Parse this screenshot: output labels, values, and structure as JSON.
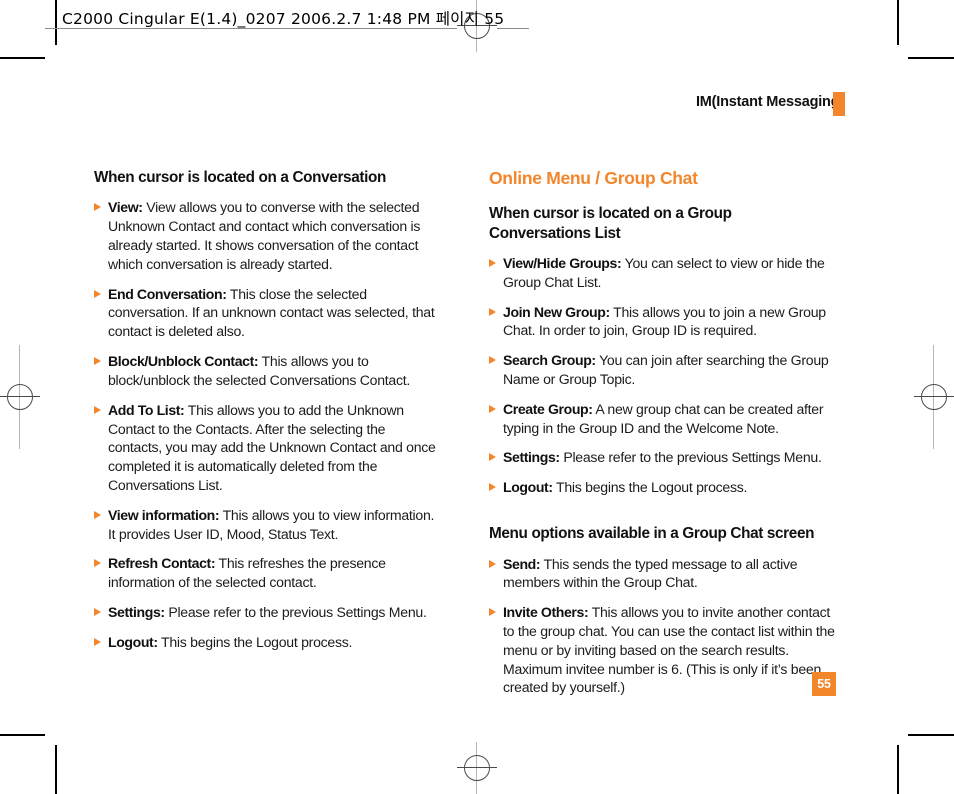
{
  "prepress": {
    "slug": "C2000 Cingular  E(1.4)_0207  2006.2.7 1:48 PM  페이지 55"
  },
  "running_head": {
    "label": "IM(Instant Messaging)"
  },
  "folio": {
    "page_number": "55"
  },
  "colors": {
    "accent": "#F3852B",
    "text": "#1c1c1c",
    "heading": "#111111",
    "folio_text": "#ffffff"
  },
  "columns": {
    "left": {
      "heading": "When cursor is located on a Conversation",
      "items": [
        {
          "term": "View:",
          "desc": " View allows you to converse with the selected Unknown Contact and contact which conversation is already started. It shows conversation of the contact which conversation is already started."
        },
        {
          "term": "End Conversation:",
          "desc": " This close the selected conversation. If an unknown contact was selected, that contact is deleted also."
        },
        {
          "term": "Block/Unblock Contact:",
          "desc": " This allows you to block/unblock the selected Conversations Contact."
        },
        {
          "term": "Add To List:",
          "desc": " This allows you to add the Unknown Contact to the Contacts. After the selecting the contacts, you may add the Unknown Contact and once completed it is automatically deleted from the Conversations List."
        },
        {
          "term": "View information:",
          "desc": " This allows you to view information. It provides User ID, Mood, Status Text."
        },
        {
          "term": "Refresh Contact:",
          "desc": " This refreshes the presence information of the selected contact."
        },
        {
          "term": "Settings:",
          "desc": " Please refer to the previous Settings Menu."
        },
        {
          "term": "Logout:",
          "desc": " This begins the Logout process."
        }
      ]
    },
    "right": {
      "section_title": "Online Menu / Group Chat",
      "heading_1": "When cursor is located on a Group Conversations List",
      "items_1": [
        {
          "term": "View/Hide Groups:",
          "desc": " You can select to view or hide the Group Chat List."
        },
        {
          "term": "Join New Group:",
          "desc": " This allows you to join a new Group Chat. In order to join, Group ID is required."
        },
        {
          "term": "Search Group:",
          "desc": " You can join after searching the Group Name or Group Topic."
        },
        {
          "term": "Create Group:",
          "desc": " A new group chat can be created after typing in the Group ID and the Welcome Note."
        },
        {
          "term": "Settings:",
          "desc": " Please refer to the previous Settings Menu."
        },
        {
          "term": "Logout:",
          "desc": " This begins the Logout process."
        }
      ],
      "heading_2": "Menu options available in a Group Chat screen",
      "items_2": [
        {
          "term": "Send:",
          "desc": " This sends the typed message to all active members within the Group Chat."
        },
        {
          "term": "Invite Others:",
          "desc": " This allows you to invite another contact to the group chat. You can use the contact list within the menu or by inviting based on the search results. Maximum invitee number is 6. (This is only if it’s been created by yourself.)"
        }
      ]
    }
  }
}
